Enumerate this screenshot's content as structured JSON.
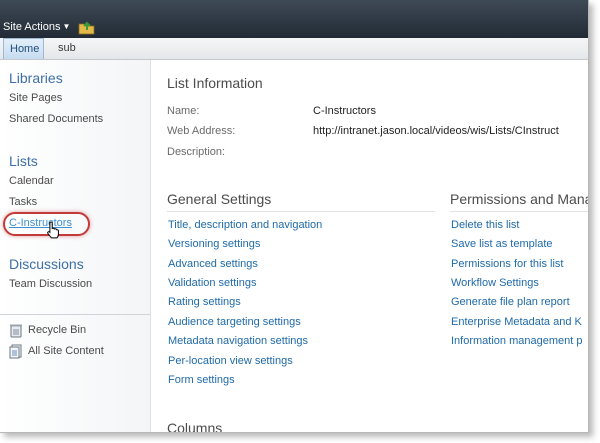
{
  "ribbon": {
    "site_actions": "Site Actions"
  },
  "topnav": {
    "tabs": [
      "Home",
      "sub"
    ]
  },
  "quicklaunch": {
    "libraries": {
      "heading": "Libraries",
      "items": [
        "Site Pages",
        "Shared Documents"
      ]
    },
    "lists": {
      "heading": "Lists",
      "items": [
        "Calendar",
        "Tasks",
        "C-Instructors"
      ]
    },
    "discussions": {
      "heading": "Discussions",
      "items": [
        "Team Discussion"
      ]
    },
    "recycle_bin": "Recycle Bin",
    "all_site_content": "All Site Content"
  },
  "list_info": {
    "title": "List Information",
    "name_label": "Name:",
    "name_value": "C-Instructors",
    "web_label": "Web Address:",
    "web_value": "http://intranet.jason.local/videos/wis/Lists/CInstruct",
    "desc_label": "Description:"
  },
  "general_settings": {
    "title": "General Settings",
    "links": [
      "Title, description and navigation",
      "Versioning settings",
      "Advanced settings",
      "Validation settings",
      "Rating settings",
      "Audience targeting settings",
      "Metadata navigation settings",
      "Per-location view settings",
      "Form settings"
    ]
  },
  "permissions": {
    "title": "Permissions and Mana",
    "links": [
      "Delete this list",
      "Save list as template",
      "Permissions for this list",
      "Workflow Settings",
      "Generate file plan report",
      "Enterprise Metadata and K",
      "Information management p"
    ]
  },
  "columns": {
    "title": "Columns"
  },
  "colors": {
    "ribbon_dark": "#222b35",
    "link_blue": "#1f6aa8",
    "heading_blue": "#3d6fa6",
    "highlight_red": "#c23a3a"
  }
}
